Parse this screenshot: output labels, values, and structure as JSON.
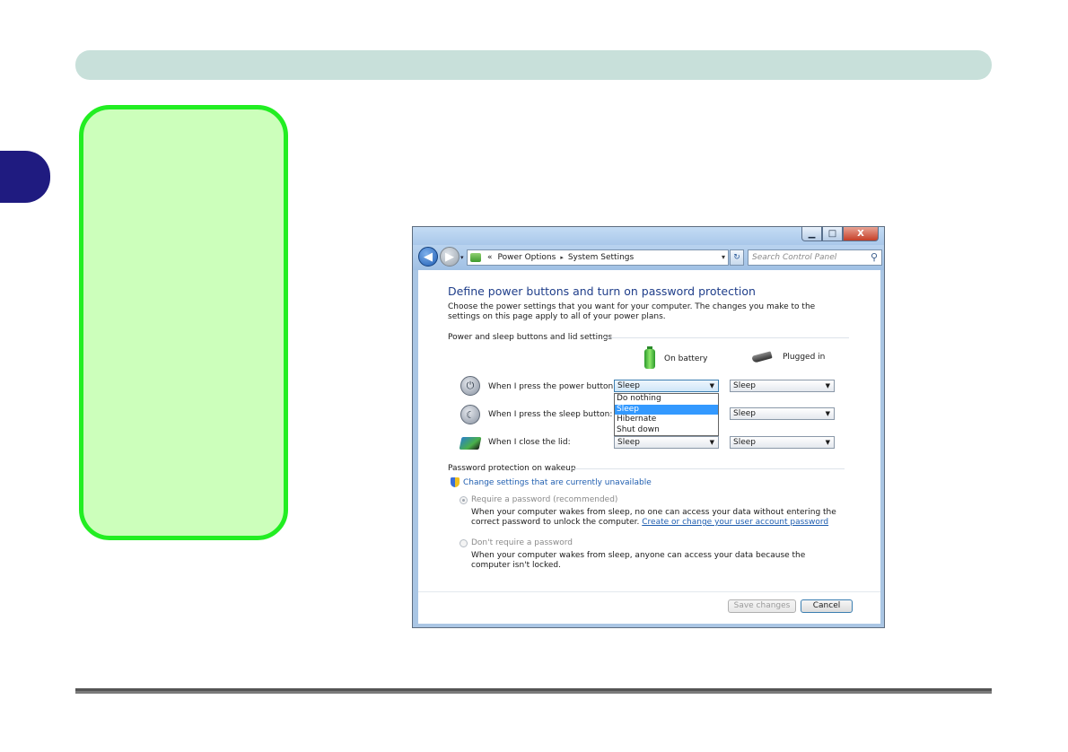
{
  "window": {
    "caption": {
      "minimize": "▁",
      "maximize": "□",
      "close": "X"
    },
    "address": {
      "separator": "«",
      "segment1": "Power Options",
      "arrow": "▸",
      "segment2": "System Settings",
      "dropdown": "▾"
    },
    "refresh": "↻",
    "search": {
      "placeholder": "Search Control Panel"
    }
  },
  "content": {
    "title": "Define power buttons and turn on password protection",
    "description": "Choose the power settings that you want for your computer. The changes you make to the settings on this page apply to all of your power plans.",
    "section_buttons": "Power and sleep buttons and lid settings",
    "columns": {
      "battery": "On battery",
      "plugged": "Plugged in"
    },
    "rows": [
      {
        "label": "When I press the power button:",
        "battery_value": "Sleep",
        "plugged_value": "Sleep"
      },
      {
        "label": "When I press the sleep button:",
        "battery_value": "Sleep",
        "plugged_value": "Sleep"
      },
      {
        "label": "When I close the lid:",
        "battery_value": "Sleep",
        "plugged_value": "Sleep"
      }
    ],
    "dropdown_options": [
      "Do nothing",
      "Sleep",
      "Hibernate",
      "Shut down"
    ],
    "dropdown_selected": "Sleep",
    "section_password": "Password protection on wakeup",
    "change_link": "Change settings that are currently unavailable",
    "require_password": {
      "label": "Require a password (recommended)",
      "text": "When your computer wakes from sleep, no one can access your data without entering the correct password to unlock the computer.",
      "link": "Create or change your user account password"
    },
    "no_password": {
      "label": "Don't require a password",
      "text": "When your computer wakes from sleep, anyone can access your data because the computer isn't locked."
    },
    "buttons": {
      "save": "Save changes",
      "cancel": "Cancel"
    }
  },
  "icons": {
    "back": "back-arrow-icon",
    "forward": "forward-arrow-icon",
    "power": "power-button-icon",
    "sleep": "moon-icon",
    "lid": "laptop-lid-icon",
    "battery": "battery-icon",
    "plug": "power-plug-icon",
    "shield": "uac-shield-icon"
  },
  "colors": {
    "link": "#1f5eb0",
    "title": "#1f3e8a",
    "selection": "#3399ff",
    "note_border": "#22ee22",
    "note_fill": "#ccffbb",
    "tab": "#1f1b80"
  }
}
